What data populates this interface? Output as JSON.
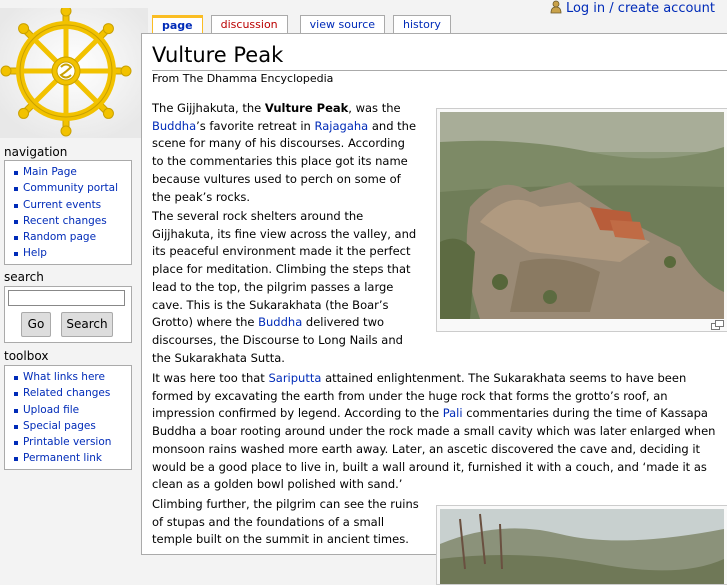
{
  "personal": {
    "login_label": "Log in / create account"
  },
  "tabs": [
    {
      "label": "page"
    },
    {
      "label": "discussion"
    },
    {
      "label": "view source"
    },
    {
      "label": "history"
    }
  ],
  "sidebar": {
    "navigation": {
      "title": "navigation",
      "items": [
        "Main Page",
        "Community portal",
        "Current events",
        "Recent changes",
        "Random page",
        "Help"
      ]
    },
    "search": {
      "title": "search",
      "input_value": "",
      "go_label": "Go",
      "search_label": "Search"
    },
    "toolbox": {
      "title": "toolbox",
      "items": [
        "What links here",
        "Related changes",
        "Upload file",
        "Special pages",
        "Printable version",
        "Permanent link"
      ]
    }
  },
  "article": {
    "title": "Vulture Peak",
    "site_sub": "From The Dhamma Encyclopedia",
    "p1": {
      "a": "The Gijjhakuta, the ",
      "b": "Vulture Peak",
      "c": ", was the",
      "d": "Buddha",
      "e": "’s favorite retreat in ",
      "f": "Rajagaha",
      "g": " and the",
      "h": "scene for many of his discourses. According",
      "i": "to the commentaries this place got its name",
      "j": "because vultures used to perch on some of",
      "k": "the peak’s rocks."
    },
    "p2": {
      "l1": "The several rock shelters around the",
      "l2": "Gijjhakuta, its fine view across the valley, and",
      "l3": "its peaceful environment made it the perfect",
      "l4": "place for meditation. Climbing the steps that",
      "l5": "lead to the top, the pilgrim passes a large",
      "l6": "cave. This is the Sukarakhata (the Boar’s",
      "l7a": "Grotto) where the ",
      "l7b": "Buddha",
      "l7c": " delivered two",
      "l8": "discourses, the Discourse to Long Nails and",
      "l9": "the Sukarakhata Sutta."
    },
    "p3": {
      "l1a": "It was here too that ",
      "l1b": "Sariputta",
      "l1c": " attained enlightenment. The Sukarakhata seems to have been",
      "l2": "formed by excavating the earth from under the huge rock that forms the grotto’s roof, an",
      "l3a": "impression confirmed by legend. According to the ",
      "l3b": "Pali",
      "l3c": " commentaries during the time of Kassapa",
      "l4": "Buddha a boar rooting around under the rock made a small cavity which was later enlarged when",
      "l5": "monsoon rains washed more earth away. Later, an ascetic discovered the cave and, deciding it",
      "l6": "would be a good place to live in, built a wall around it, furnished it with a couch, and ‘made it as",
      "l7": "clean as a golden bowl polished with sand.’"
    },
    "p4": {
      "l1": "Climbing further, the pilgrim can see the ruins",
      "l2": "of stupas and the foundations of a small",
      "l3": "temple built on the summit in ancient times."
    }
  },
  "colors": {
    "link": "#002bb8",
    "new_link": "#ba0000",
    "tab_accent": "#fabd23",
    "logo_gold": "#f2c200"
  },
  "icons": [
    "user-icon",
    "dharma-wheel-logo",
    "magnify-icon"
  ]
}
